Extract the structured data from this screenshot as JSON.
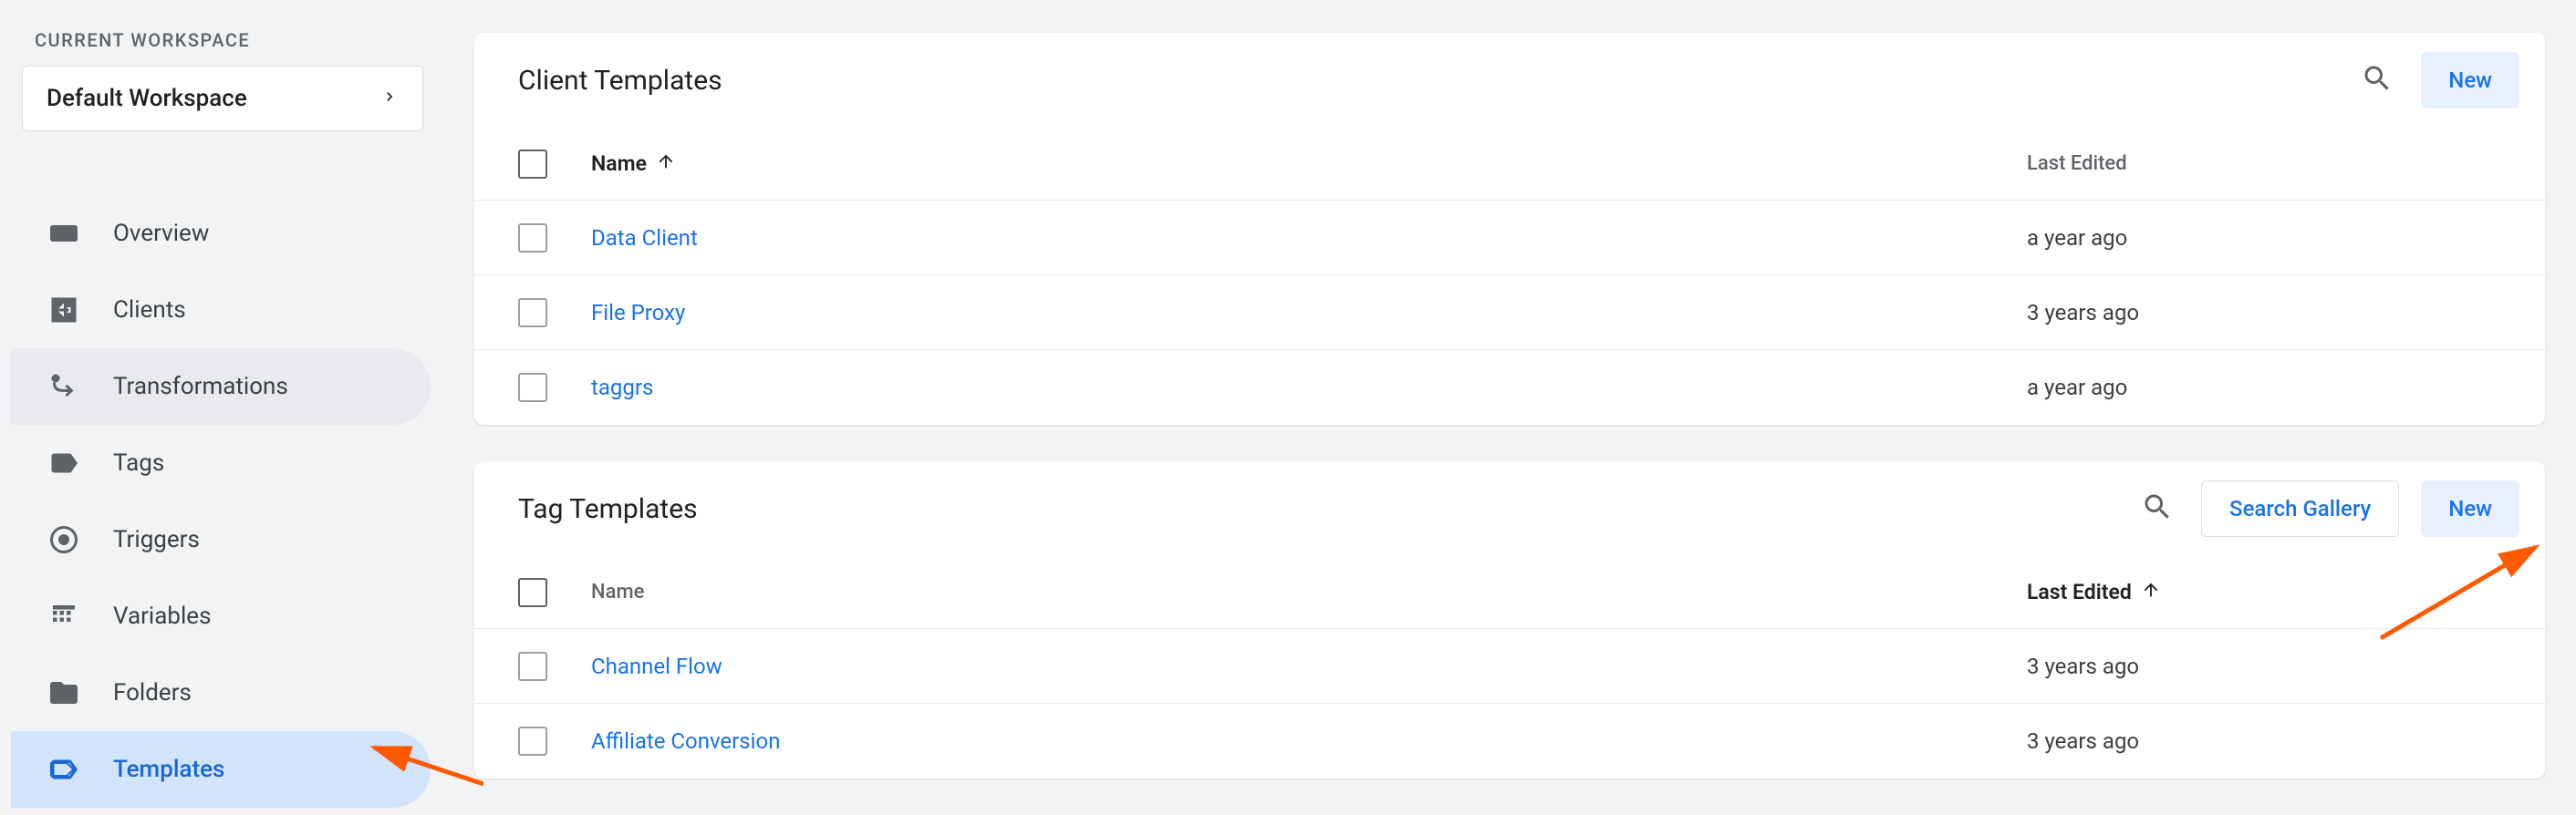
{
  "sidebar": {
    "workspace_label": "CURRENT WORKSPACE",
    "workspace_name": "Default Workspace",
    "items": [
      {
        "label": "Overview"
      },
      {
        "label": "Clients"
      },
      {
        "label": "Transformations"
      },
      {
        "label": "Tags"
      },
      {
        "label": "Triggers"
      },
      {
        "label": "Variables"
      },
      {
        "label": "Folders"
      },
      {
        "label": "Templates"
      }
    ]
  },
  "panels": {
    "client_templates": {
      "title": "Client Templates",
      "new_label": "New",
      "columns": {
        "name": "Name",
        "last_edited": "Last Edited"
      },
      "rows": [
        {
          "name": "Data Client",
          "edited": "a year ago"
        },
        {
          "name": "File Proxy",
          "edited": "3 years ago"
        },
        {
          "name": "taggrs",
          "edited": "a year ago"
        }
      ]
    },
    "tag_templates": {
      "title": "Tag Templates",
      "search_gallery_label": "Search Gallery",
      "new_label": "New",
      "columns": {
        "name": "Name",
        "last_edited": "Last Edited"
      },
      "rows": [
        {
          "name": "Channel Flow",
          "edited": "3 years ago"
        },
        {
          "name": "Affiliate Conversion",
          "edited": "3 years ago"
        }
      ]
    }
  }
}
